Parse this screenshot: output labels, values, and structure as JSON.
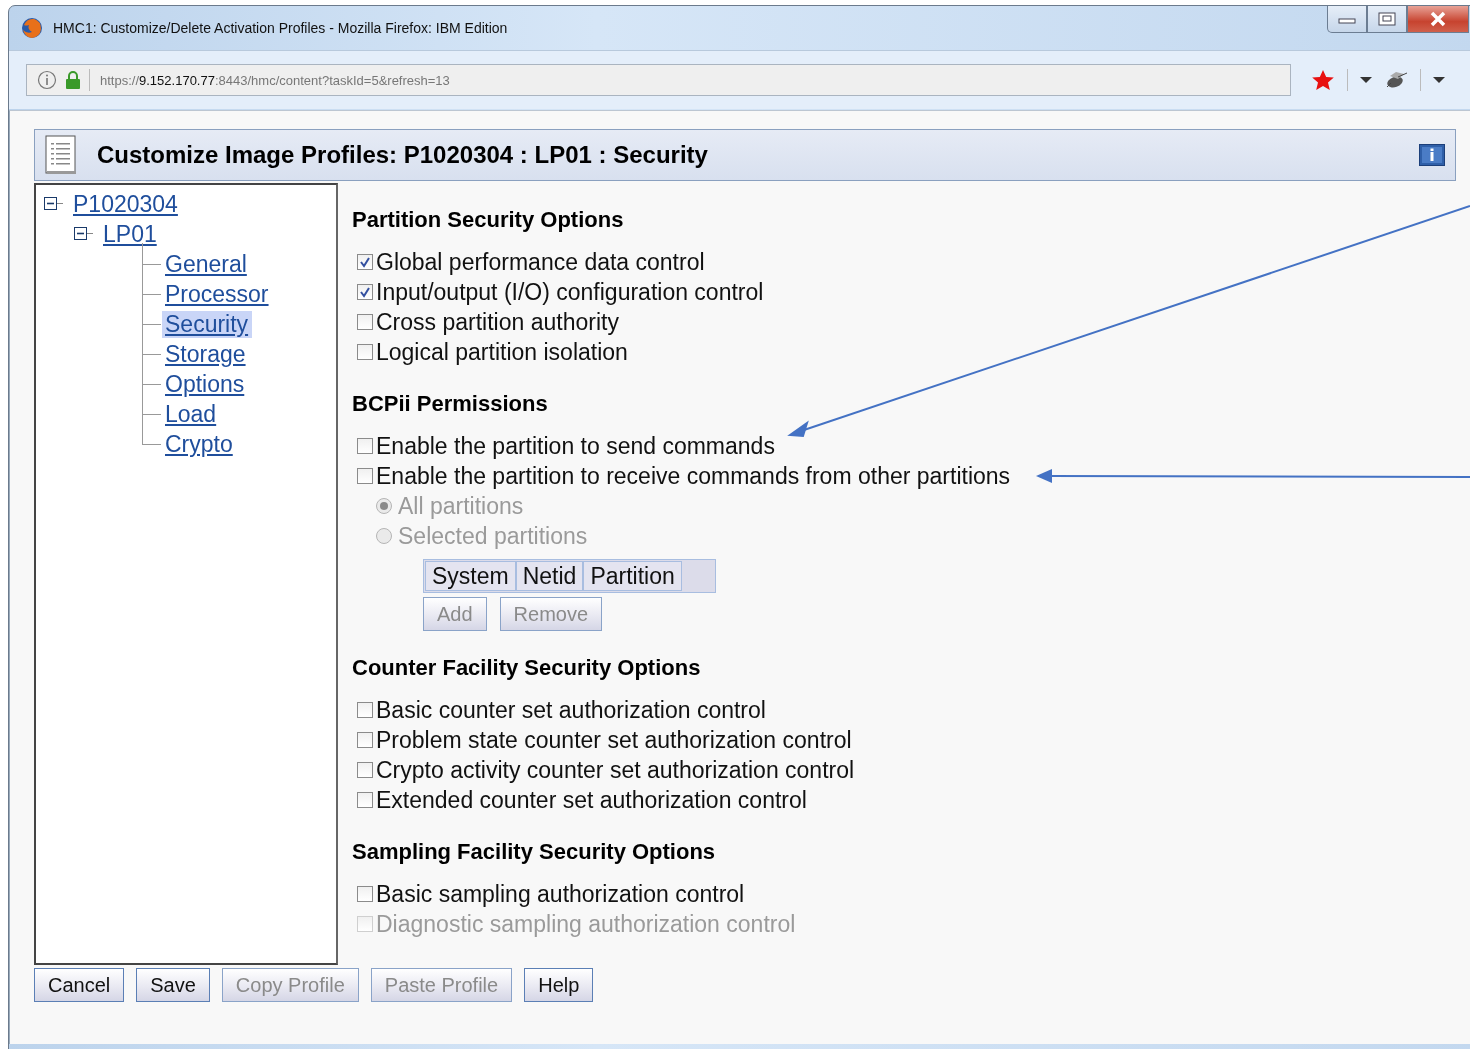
{
  "window": {
    "title": "HMC1: Customize/Delete Activation Profiles - Mozilla Firefox: IBM Edition"
  },
  "address_bar": {
    "url": "https://**9.152.170.77**:8443/hmc/content?taskId=5&refresh=13"
  },
  "header": {
    "title": "Customize Image Profiles: P1020304 : LP01 : Security"
  },
  "tree": [
    {
      "label": "P1020304",
      "expanded": true,
      "children": [
        {
          "label": "LP01",
          "expanded": true,
          "children": [
            {
              "label": "General",
              "selected": false
            },
            {
              "label": "Processor",
              "selected": false
            },
            {
              "label": "Security",
              "selected": true
            },
            {
              "label": "Storage",
              "selected": false
            },
            {
              "label": "Options",
              "selected": false
            },
            {
              "label": "Load",
              "selected": false
            },
            {
              "label": "Crypto",
              "selected": false
            }
          ]
        }
      ]
    }
  ],
  "sections": [
    {
      "title": "Partition Security Options",
      "items": [
        {
          "kind": "checkbox",
          "label": "Global performance data control",
          "checked": true,
          "disabled": false
        },
        {
          "kind": "checkbox",
          "label": "Input/output (I/O) configuration control",
          "checked": true,
          "disabled": false
        },
        {
          "kind": "checkbox",
          "label": "Cross partition authority",
          "checked": false,
          "disabled": false
        },
        {
          "kind": "checkbox",
          "label": "Logical partition isolation",
          "checked": false,
          "disabled": false
        }
      ]
    },
    {
      "title": "BCPii Permissions",
      "items": [
        {
          "kind": "checkbox",
          "label": "Enable the partition to send commands",
          "checked": false,
          "disabled": false
        },
        {
          "kind": "checkbox",
          "label": "Enable the partition to receive commands from other partitions",
          "checked": false,
          "disabled": false
        },
        {
          "kind": "radio",
          "label": "All partitions",
          "selected": true,
          "disabled": true
        },
        {
          "kind": "radio",
          "label": "Selected partitions",
          "selected": false,
          "disabled": true
        },
        {
          "kind": "table",
          "columns": [
            "System",
            "Netid",
            "Partition"
          ]
        },
        {
          "kind": "buttons",
          "buttons": [
            {
              "label": "Add",
              "disabled": true
            },
            {
              "label": "Remove",
              "disabled": true
            }
          ]
        }
      ]
    },
    {
      "title": "Counter Facility Security Options",
      "items": [
        {
          "kind": "checkbox",
          "label": "Basic counter set authorization control",
          "checked": false,
          "disabled": false
        },
        {
          "kind": "checkbox",
          "label": "Problem state counter set authorization control",
          "checked": false,
          "disabled": false
        },
        {
          "kind": "checkbox",
          "label": "Crypto activity counter set authorization control",
          "checked": false,
          "disabled": false
        },
        {
          "kind": "checkbox",
          "label": "Extended counter set authorization control",
          "checked": false,
          "disabled": false
        }
      ]
    },
    {
      "title": "Sampling Facility Security Options",
      "items": [
        {
          "kind": "checkbox",
          "label": "Basic sampling authorization control",
          "checked": false,
          "disabled": false
        },
        {
          "kind": "checkbox",
          "label": "Diagnostic sampling authorization control",
          "checked": false,
          "disabled": true
        }
      ]
    }
  ],
  "buttons": [
    {
      "label": "Cancel",
      "disabled": false
    },
    {
      "label": "Save",
      "disabled": false
    },
    {
      "label": "Copy Profile",
      "disabled": true
    },
    {
      "label": "Paste Profile",
      "disabled": true
    },
    {
      "label": "Help",
      "disabled": false
    }
  ]
}
